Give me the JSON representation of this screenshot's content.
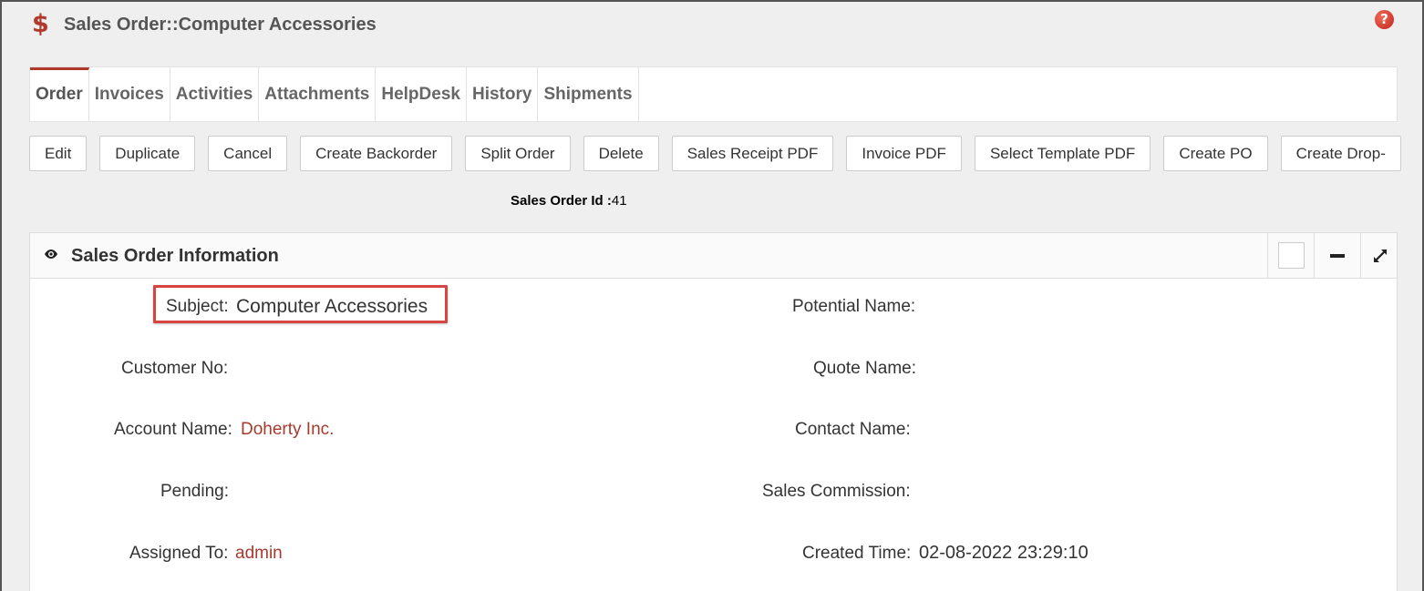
{
  "header": {
    "icon": "dollar-icon",
    "title": "Sales Order::Computer Accessories",
    "help_icon": "help-icon",
    "help_glyph": "?",
    "accent_color": "#b0392b"
  },
  "tabs": [
    {
      "label": "Order",
      "active": true
    },
    {
      "label": "Invoices",
      "active": false
    },
    {
      "label": "Activities",
      "active": false
    },
    {
      "label": "Attachments",
      "active": false
    },
    {
      "label": "HelpDesk",
      "active": false
    },
    {
      "label": "History",
      "active": false
    },
    {
      "label": "Shipments",
      "active": false
    }
  ],
  "toolbar": {
    "buttons": [
      "Edit",
      "Duplicate",
      "Cancel",
      "Create Backorder",
      "Split Order",
      "Delete",
      "Sales Receipt PDF",
      "Invoice PDF",
      "Select Template PDF",
      "Create PO",
      "Create Drop-"
    ]
  },
  "sales_order_id": {
    "label": "Sales Order Id :",
    "value": "41"
  },
  "panel": {
    "title": "Sales Order Information",
    "icon": "eye-icon",
    "controls": [
      "checkbox-icon",
      "minimize-icon",
      "expand-icon"
    ],
    "fields": {
      "subject": {
        "label": "Subject:",
        "value": "Computer Accessories"
      },
      "potential_name": {
        "label": "Potential Name:",
        "value": ""
      },
      "customer_no": {
        "label": "Customer No:",
        "value": ""
      },
      "quote_name": {
        "label": "Quote Name:",
        "value": ""
      },
      "account_name": {
        "label": "Account Name:",
        "value": "Doherty Inc."
      },
      "contact_name": {
        "label": "Contact Name:",
        "value": ""
      },
      "pending": {
        "label": "Pending:",
        "value": ""
      },
      "sales_commission": {
        "label": "Sales Commission:",
        "value": ""
      },
      "assigned_to": {
        "label": "Assigned To:",
        "value": "admin"
      },
      "created_time": {
        "label": "Created Time:",
        "value": "02-08-2022 23:29:10"
      }
    },
    "link_color": "#a63a2d",
    "highlight_color": "#d64541"
  }
}
